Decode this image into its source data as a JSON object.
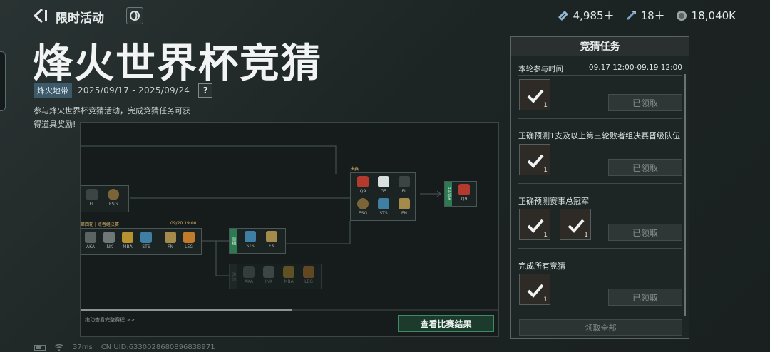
{
  "header": {
    "back_label": "限时活动",
    "currencies": [
      {
        "icon": "ticket-icon",
        "value": "4,985＋"
      },
      {
        "icon": "diamond-icon",
        "value": "18＋"
      },
      {
        "icon": "coin-icon",
        "value": "18,040K"
      }
    ]
  },
  "event": {
    "title": "烽火世界杯竞猜",
    "tag": "烽火地带",
    "date_range": "2025/09/17 - 2025/09/24",
    "help": "?",
    "description": "参与烽火世界杯竞猜活动，完成竞猜任务可获得道具奖励!"
  },
  "bracket": {
    "upper_left_teams": [
      "FL",
      "ESG"
    ],
    "losers_round_label": "第四轮 | 败者组决赛",
    "losers_round_date": "09/20 19:00",
    "losers_round_teams": [
      "AKA",
      "INK",
      "MBA",
      "STS",
      "FN",
      "LEG"
    ],
    "advance_label": "晋级",
    "advance_teams": [
      "STS",
      "FN"
    ],
    "eliminated_label": "淘汰",
    "eliminated_teams": [
      "AKA",
      "INK",
      "MBA",
      "LEG"
    ],
    "final_label": "决赛",
    "final_teams": [
      "Q9",
      "G5",
      "FL",
      "ESG",
      "STS",
      "FN"
    ],
    "champion_label": "总冠军",
    "champion_team": "Q9",
    "scroll_hint": "拖动查看完整赛程 >>",
    "result_button": "查看比赛结果"
  },
  "quiz": {
    "title": "竞猜任务",
    "round_time_label": "本轮参与时间",
    "round_time_value": "09.17 12:00-09.19 12:00",
    "tasks": [
      {
        "label": "",
        "rewards": [
          "1"
        ],
        "status": "已领取"
      },
      {
        "label": "正确预测1支及以上第三轮败者组决赛晋级队伍",
        "rewards": [
          "1"
        ],
        "status": "已领取"
      },
      {
        "label": "正确预测赛事总冠军",
        "rewards": [
          "1",
          "1"
        ],
        "status": "已领取"
      },
      {
        "label": "完成所有竞猜",
        "rewards": [
          "1"
        ],
        "status": "已领取"
      }
    ],
    "claim_all": "领取全部"
  },
  "status_bar": {
    "ping": "37ms",
    "uid": "CN UID:6330028680896838971"
  },
  "colors": {
    "accent_green": "#2c7a52",
    "tag_blue": "#3d5a6b",
    "background": "#1f2727"
  }
}
